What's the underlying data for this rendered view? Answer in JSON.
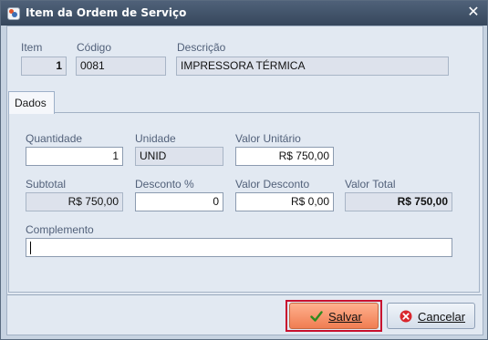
{
  "window": {
    "title": "Item da Ordem de Serviço",
    "close_symbol": "✕"
  },
  "header": {
    "item_label": "Item",
    "item_value": "1",
    "codigo_label": "Código",
    "codigo_value": "0081",
    "descricao_label": "Descrição",
    "descricao_value": "IMPRESSORA TÉRMICA"
  },
  "tabs": [
    {
      "label": "Dados"
    }
  ],
  "dados": {
    "quantidade_label": "Quantidade",
    "quantidade_value": "1",
    "unidade_label": "Unidade",
    "unidade_value": "UNID",
    "valor_unitario_label": "Valor Unitário",
    "valor_unitario_value": "R$ 750,00",
    "subtotal_label": "Subtotal",
    "subtotal_value": "R$ 750,00",
    "desconto_pct_label": "Desconto %",
    "desconto_pct_value": "0",
    "valor_desconto_label": "Valor Desconto",
    "valor_desconto_value": "R$ 0,00",
    "valor_total_label": "Valor Total",
    "valor_total_value": "R$ 750,00",
    "complemento_label": "Complemento",
    "complemento_value": ""
  },
  "buttons": {
    "save_label": "Salvar",
    "cancel_label": "Cancelar"
  },
  "icons": {
    "save": "check-icon",
    "cancel": "x-icon",
    "app": "app-icon",
    "close": "close-icon"
  },
  "colors": {
    "accent_focus": "#c8102e",
    "save_button": "#f07d52",
    "titlebar": "#3d4e63"
  }
}
